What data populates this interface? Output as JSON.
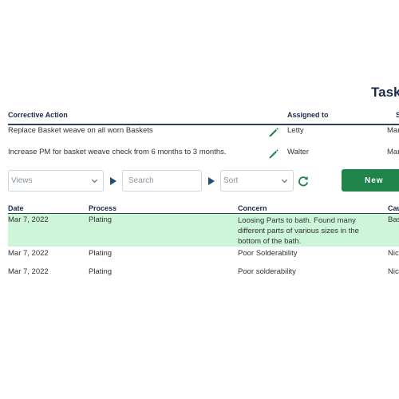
{
  "title": "Tasks",
  "corrective_actions": {
    "columns": [
      "Corrective Action",
      "Assigned to",
      "S"
    ],
    "rows": [
      {
        "action": "Replace Basket weave on all worn Baskets",
        "assigned": "Letty",
        "date": "Mar"
      },
      {
        "action": "Increase PM for basket weave check from 6 months to 3 months.",
        "assigned": "Walter",
        "date": "Mar"
      }
    ]
  },
  "toolbar": {
    "views_placeholder": "Views",
    "search_placeholder": "Search",
    "sort_placeholder": "Sort",
    "new_label": "New"
  },
  "concerns": {
    "columns": [
      "Date",
      "Process",
      "Concern",
      "Cau"
    ],
    "rows": [
      {
        "date": "Mar 7, 2022",
        "process": "Plating",
        "concern": "Loosing Parts to bath. Found many different parts of various sizes in the bottom of the bath.",
        "cause": "Bas",
        "highlighted": true
      },
      {
        "date": "Mar 7, 2022",
        "process": "Plating",
        "concern": "Poor Solderability",
        "cause": "Nic",
        "highlighted": false
      },
      {
        "date": "Mar 7, 2022",
        "process": "Plating",
        "concern": "Poor solderability",
        "cause": "Nic",
        "highlighted": false
      }
    ]
  },
  "colors": {
    "accent": "#1e8449",
    "header_text": "#1c2b4a",
    "highlight_row": "#ccf5d9",
    "arrow": "#1f4e79"
  }
}
